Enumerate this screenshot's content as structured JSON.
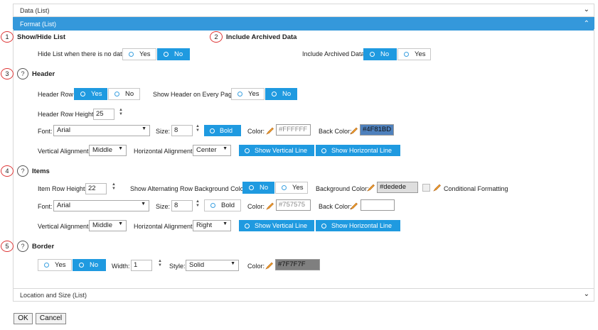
{
  "panels": {
    "data_list": "Data (List)",
    "format_list": "Format (List)",
    "location_size": "Location and Size (List)"
  },
  "sections": {
    "show_hide": {
      "num": "1",
      "title": "Show/Hide List",
      "hide_label": "Hide List when there is no data",
      "yes": "Yes",
      "no": "No",
      "selected": "No"
    },
    "archived": {
      "num": "2",
      "title": "Include Archived Data",
      "label": "Include Archived Data",
      "no": "No",
      "yes": "Yes",
      "selected": "No"
    },
    "header": {
      "num": "3",
      "help": "?",
      "title": "Header",
      "header_row_label": "Header Row",
      "yes": "Yes",
      "no": "No",
      "header_row_selected": "Yes",
      "show_every_page_label": "Show Header on Every Page",
      "show_every_page_selected": "No",
      "row_height_label": "Header Row Height",
      "row_height": "25",
      "font_label": "Font:",
      "font": "Arial",
      "size_label": "Size:",
      "size": "8",
      "bold": "Bold",
      "color_label": "Color:",
      "color": "#FFFFFF",
      "back_color_label": "Back Color:",
      "back_color": "#4F81BD",
      "valign_label": "Vertical Alignment:",
      "valign": "Middle",
      "halign_label": "Horizontal Alignment:",
      "halign": "Center",
      "show_vertical": "Show Vertical Line",
      "show_horizontal": "Show Horizontal Line"
    },
    "items": {
      "num": "4",
      "help": "?",
      "title": "Items",
      "row_height_label": "Item Row Height",
      "row_height": "22",
      "alt_bg_label": "Show Alternating Row Background Color",
      "no": "No",
      "yes": "Yes",
      "alt_selected": "No",
      "bg_color_label": "Background Color:",
      "bg_color": "#dedede",
      "cond_format": "Conditional Formatting",
      "font_label": "Font:",
      "font": "Arial",
      "size_label": "Size:",
      "size": "8",
      "bold": "Bold",
      "color_label": "Color:",
      "color": "#757575",
      "back_color_label": "Back Color:",
      "back_color": "",
      "valign_label": "Vertical Alignment:",
      "valign": "Middle",
      "halign_label": "Horizontal Alignment:",
      "halign": "Right",
      "show_vertical": "Show Vertical Line",
      "show_horizontal": "Show Horizontal Line"
    },
    "border": {
      "num": "5",
      "help": "?",
      "title": "Border",
      "yes": "Yes",
      "no": "No",
      "selected": "No",
      "width_label": "Width:",
      "width": "1",
      "style_label": "Style:",
      "style": "Solid",
      "color_label": "Color:",
      "color": "#7F7F7F"
    }
  },
  "footer": {
    "ok": "OK",
    "cancel": "Cancel"
  },
  "colors": {
    "accent": "#1f9ae0",
    "header_back": "#4F81BD",
    "item_bg": "#dedede",
    "border_color": "#7F7F7F"
  }
}
